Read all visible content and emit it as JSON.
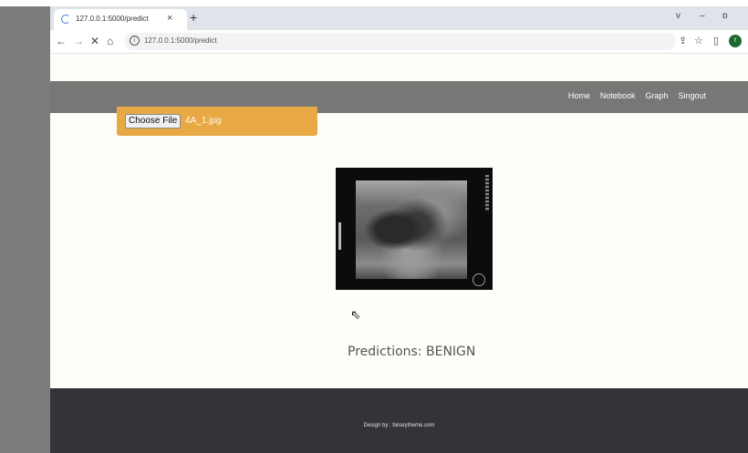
{
  "browser": {
    "tab_title": "127.0.0.1:5000/predict",
    "tab_close": "×",
    "new_tab": "+",
    "url": "127.0.0.1:5000/predict",
    "window_controls": [
      "v",
      "–",
      "ɒ"
    ],
    "profile_initial": "t"
  },
  "nav": {
    "links": [
      "Home",
      "Notebook",
      "Graph",
      "Singout"
    ]
  },
  "upload": {
    "button_label": "Choose File",
    "file_name": "4A_1.jpg"
  },
  "image": {
    "icon": "ultrasound-image"
  },
  "result": {
    "prediction_text": "Predictions: BENIGN"
  },
  "footer": {
    "text": "Design by : binarytheme.com"
  },
  "colors": {
    "nav_bg": "#777775",
    "upload_bg": "#e8a945",
    "footer_bg": "#343438",
    "page_bg": "#fffdf8"
  }
}
